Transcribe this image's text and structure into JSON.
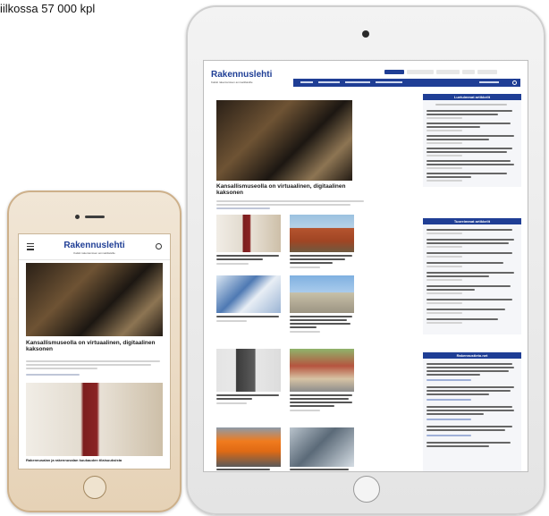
{
  "caption": "iilkossa 57 000 kpl",
  "site": {
    "logo": "Rakennuslehti",
    "tagline": "Kaikki rakentamisen ammattilaisille"
  },
  "tablet": {
    "hero_headline": "Kansallismuseolla on virtuaalinen, digitaalinen kaksonen",
    "sidebar_headings": [
      "Luetuimmat artikkelit",
      "Tuoreimmat artikkelit",
      "Rakennustieto.net"
    ]
  },
  "phone": {
    "hero_headline": "Kansallismuseolla on virtuaalinen, digitaalinen kaksonen",
    "second_headline": "Rakennusalan ja rakennusalan kuukauden tilaisuuksista"
  },
  "colors": {
    "brand": "#1f3e95",
    "phone_frame": "#e6d2b6",
    "tablet_frame": "#e4e4e4"
  }
}
